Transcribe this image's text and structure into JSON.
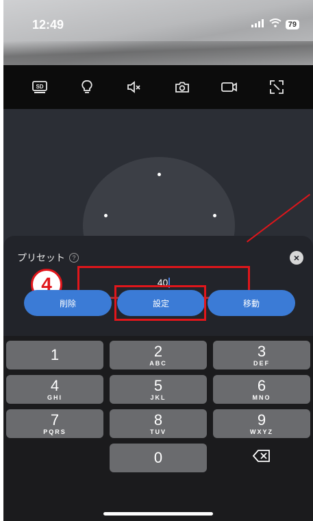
{
  "status_bar": {
    "time": "12:49",
    "battery": "79"
  },
  "toolbar": {
    "items": [
      {
        "label": "SD",
        "icon": "sd-card-icon"
      },
      {
        "icon": "light-bulb-icon"
      },
      {
        "icon": "speaker-muted-icon"
      },
      {
        "icon": "camera-icon"
      },
      {
        "icon": "video-record-icon"
      },
      {
        "icon": "fullscreen-icon"
      }
    ]
  },
  "preset": {
    "title": "プリセット",
    "input_value": "40",
    "step_marker": "4",
    "buttons": {
      "delete": "削除",
      "set": "設定",
      "move": "移動"
    }
  },
  "keypad": {
    "keys": [
      {
        "digit": "1",
        "letters": ""
      },
      {
        "digit": "2",
        "letters": "ABC"
      },
      {
        "digit": "3",
        "letters": "DEF"
      },
      {
        "digit": "4",
        "letters": "GHI"
      },
      {
        "digit": "5",
        "letters": "JKL"
      },
      {
        "digit": "6",
        "letters": "MNO"
      },
      {
        "digit": "7",
        "letters": "PQRS"
      },
      {
        "digit": "8",
        "letters": "TUV"
      },
      {
        "digit": "9",
        "letters": "WXYZ"
      },
      {
        "digit": "0",
        "letters": ""
      }
    ]
  },
  "colors": {
    "accent_red": "#e0161b",
    "button_blue": "#3b7bd6"
  }
}
